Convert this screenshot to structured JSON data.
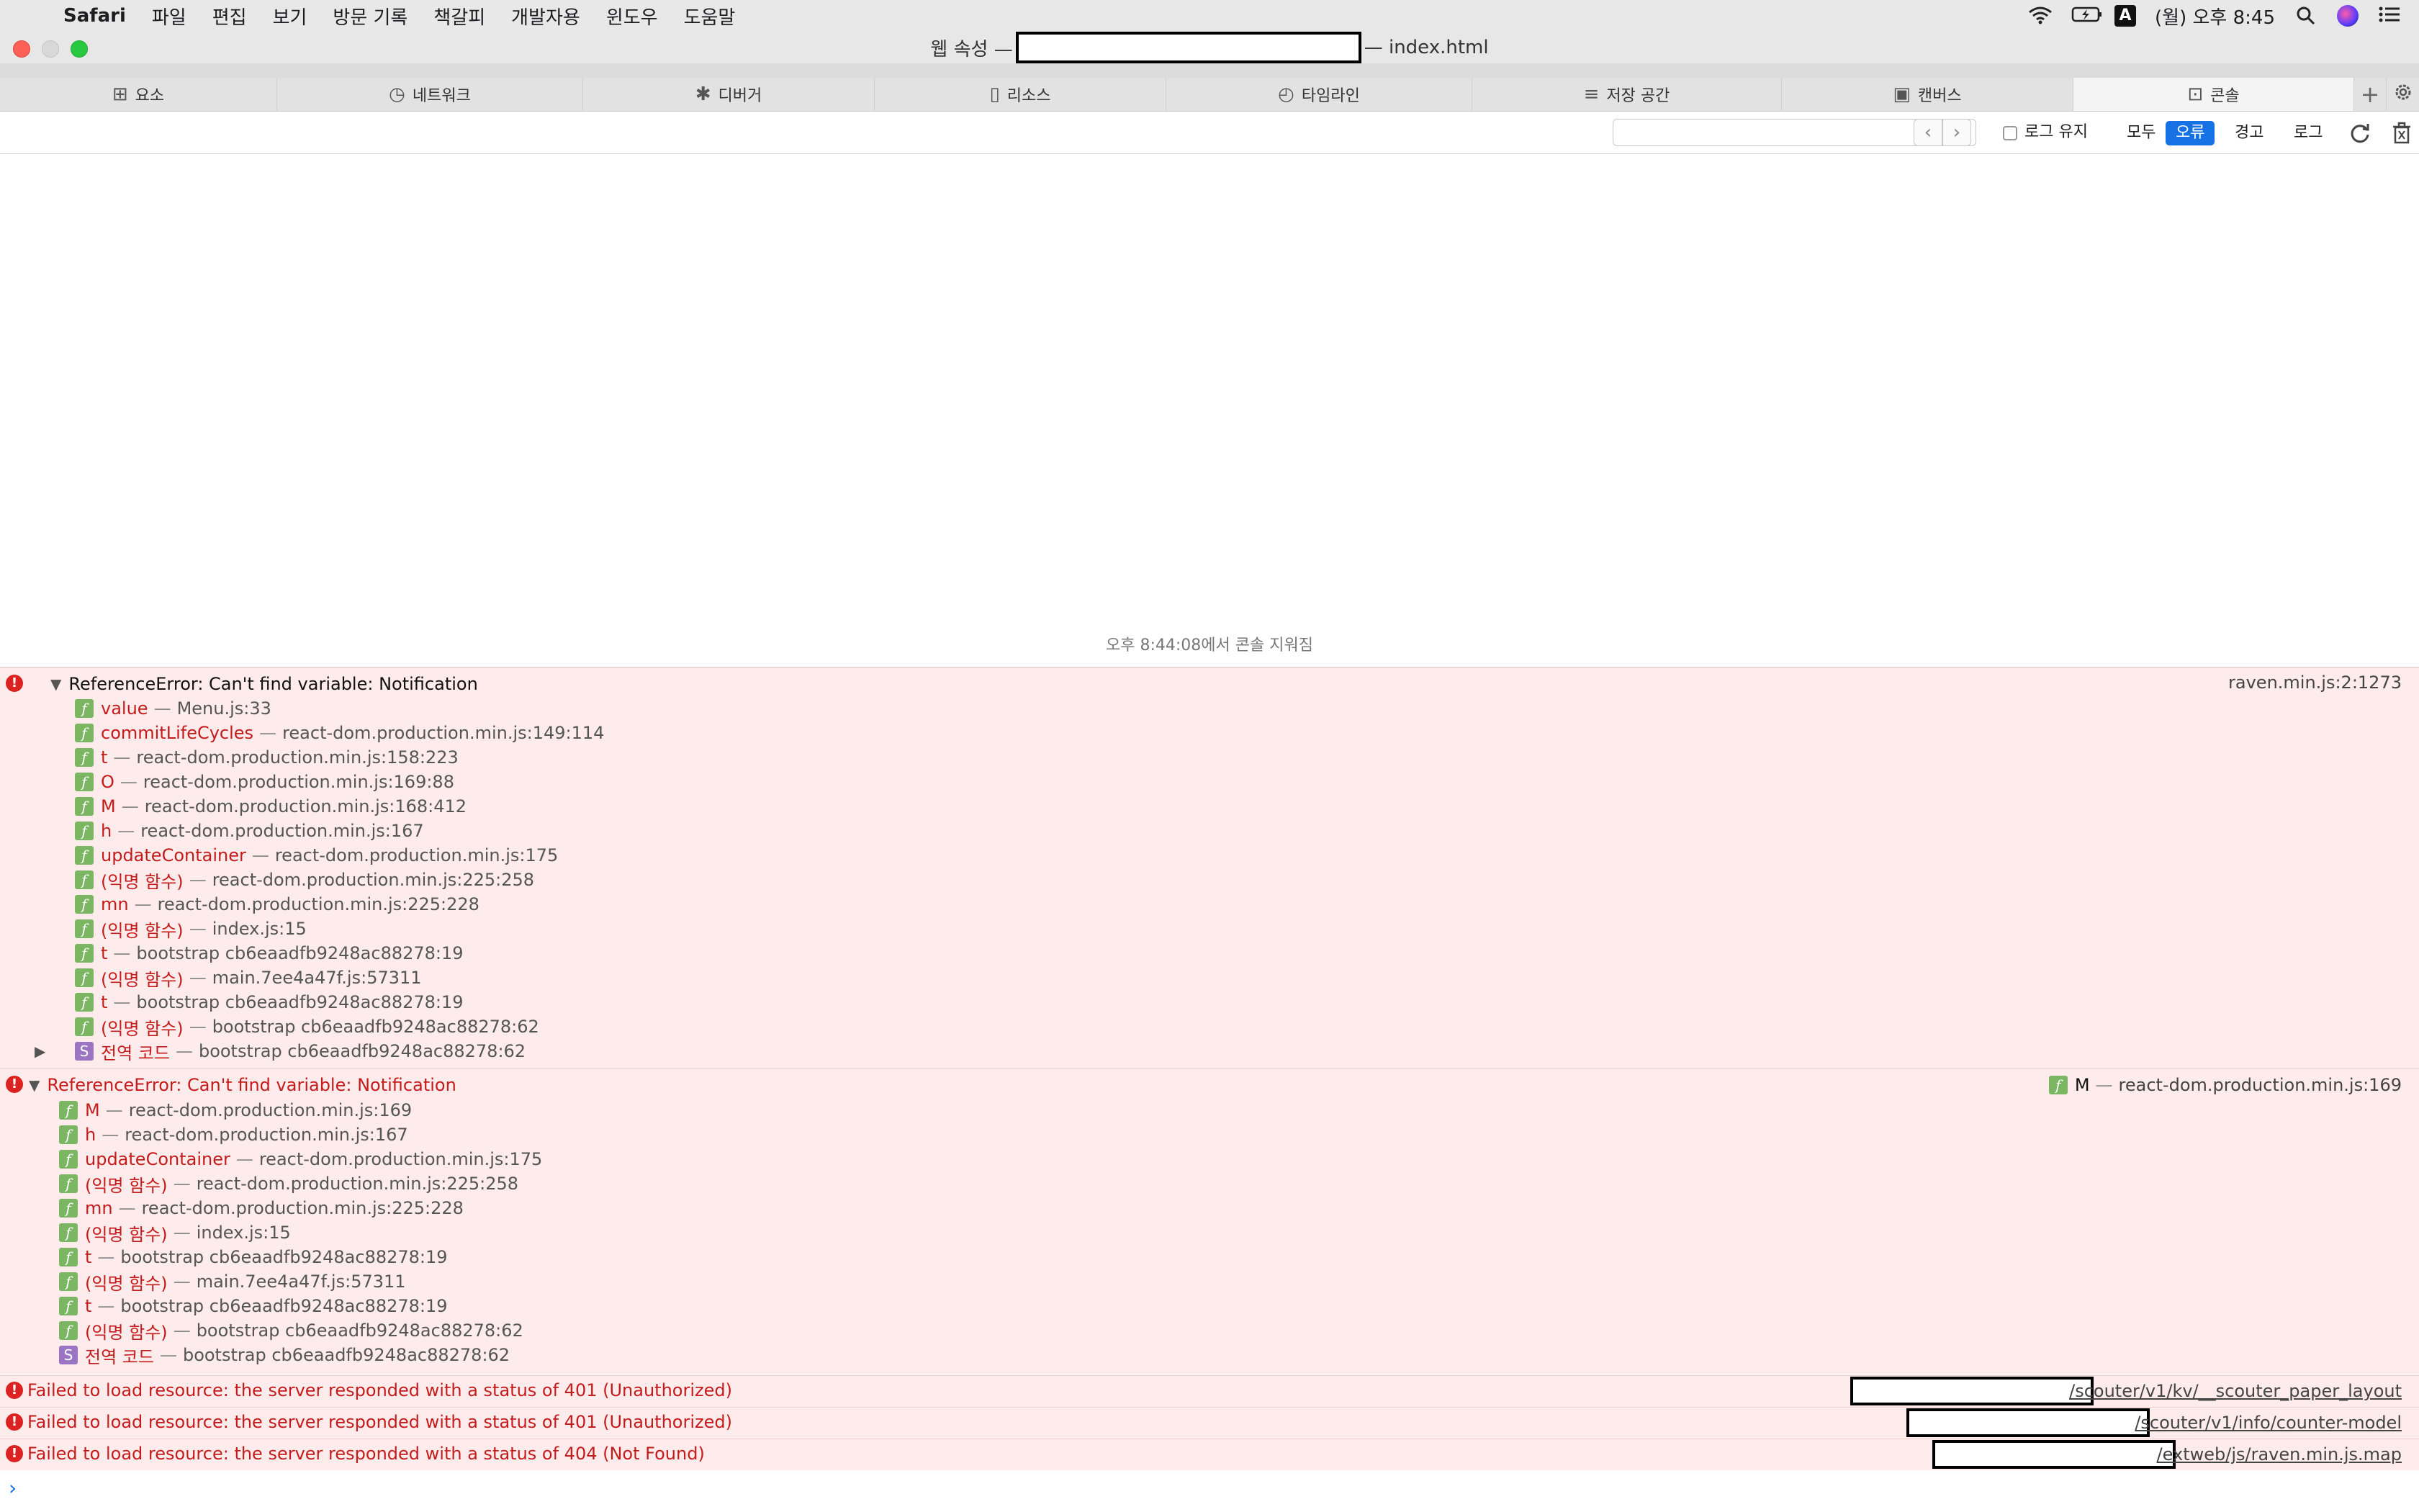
{
  "menubar": {
    "app": "Safari",
    "items": [
      "파일",
      "편집",
      "보기",
      "방문 기록",
      "책갈피",
      "개발자용",
      "윈도우",
      "도움말"
    ],
    "input_badge": "A",
    "clock": "(월) 오후 8:45"
  },
  "titlebar": {
    "prefix": "웹 속성 —",
    "suffix": "— index.html"
  },
  "tabs": [
    {
      "label": "요소",
      "icon": "elements-icon",
      "glyph": "⊞"
    },
    {
      "label": "네트워크",
      "icon": "network-icon",
      "glyph": "◷"
    },
    {
      "label": "디버거",
      "icon": "debugger-icon",
      "glyph": "✱"
    },
    {
      "label": "리소스",
      "icon": "resources-icon",
      "glyph": "▯"
    },
    {
      "label": "타임라인",
      "icon": "timeline-icon",
      "glyph": "◴"
    },
    {
      "label": "저장 공간",
      "icon": "storage-icon",
      "glyph": "≡"
    },
    {
      "label": "캔버스",
      "icon": "canvas-icon",
      "glyph": "▣"
    },
    {
      "label": "콘솔",
      "icon": "console-icon",
      "glyph": "⊡"
    }
  ],
  "toolbar": {
    "search_value": "",
    "preserve_log": "로그 유지",
    "filters": [
      "모두",
      "오류",
      "경고",
      "로그"
    ],
    "selected_filter": "오류"
  },
  "console": {
    "cleared_message": "오후 8:44:08에서 콘솔 지워짐",
    "error1": {
      "message": "ReferenceError: Can't find variable: Notification",
      "location": "raven.min.js:2:1273",
      "frames": [
        {
          "fn": "value",
          "loc": "Menu.js:33",
          "badge": "f"
        },
        {
          "fn": "commitLifeCycles",
          "loc": "react-dom.production.min.js:149:114",
          "badge": "f"
        },
        {
          "fn": "t",
          "loc": "react-dom.production.min.js:158:223",
          "badge": "f"
        },
        {
          "fn": "O",
          "loc": "react-dom.production.min.js:169:88",
          "badge": "f"
        },
        {
          "fn": "M",
          "loc": "react-dom.production.min.js:168:412",
          "badge": "f"
        },
        {
          "fn": "h",
          "loc": "react-dom.production.min.js:167",
          "badge": "f"
        },
        {
          "fn": "updateContainer",
          "loc": "react-dom.production.min.js:175",
          "badge": "f"
        },
        {
          "fn": "(익명 함수)",
          "loc": "react-dom.production.min.js:225:258",
          "badge": "f"
        },
        {
          "fn": "mn",
          "loc": "react-dom.production.min.js:225:228",
          "badge": "f"
        },
        {
          "fn": "(익명 함수)",
          "loc": "index.js:15",
          "badge": "f"
        },
        {
          "fn": "t",
          "loc": "bootstrap cb6eaadfb9248ac88278:19",
          "badge": "f"
        },
        {
          "fn": "(익명 함수)",
          "loc": "main.7ee4a47f.js:57311",
          "badge": "f"
        },
        {
          "fn": "t",
          "loc": "bootstrap cb6eaadfb9248ac88278:19",
          "badge": "f"
        },
        {
          "fn": "(익명 함수)",
          "loc": "bootstrap cb6eaadfb9248ac88278:62",
          "badge": "f"
        },
        {
          "fn": "전역 코드",
          "loc": "bootstrap cb6eaadfb9248ac88278:62",
          "badge": "S"
        }
      ]
    },
    "error2": {
      "message": "ReferenceError: Can't find variable: Notification",
      "location_fn": "M",
      "location": "react-dom.production.min.js:169",
      "frames": [
        {
          "fn": "M",
          "loc": "react-dom.production.min.js:169",
          "badge": "f"
        },
        {
          "fn": "h",
          "loc": "react-dom.production.min.js:167",
          "badge": "f"
        },
        {
          "fn": "updateContainer",
          "loc": "react-dom.production.min.js:175",
          "badge": "f"
        },
        {
          "fn": "(익명 함수)",
          "loc": "react-dom.production.min.js:225:258",
          "badge": "f"
        },
        {
          "fn": "mn",
          "loc": "react-dom.production.min.js:225:228",
          "badge": "f"
        },
        {
          "fn": "(익명 함수)",
          "loc": "index.js:15",
          "badge": "f"
        },
        {
          "fn": "t",
          "loc": "bootstrap cb6eaadfb9248ac88278:19",
          "badge": "f"
        },
        {
          "fn": "(익명 함수)",
          "loc": "main.7ee4a47f.js:57311",
          "badge": "f"
        },
        {
          "fn": "t",
          "loc": "bootstrap cb6eaadfb9248ac88278:19",
          "badge": "f"
        },
        {
          "fn": "(익명 함수)",
          "loc": "bootstrap cb6eaadfb9248ac88278:62",
          "badge": "f"
        },
        {
          "fn": "전역 코드",
          "loc": "bootstrap cb6eaadfb9248ac88278:62",
          "badge": "S"
        }
      ]
    },
    "resource_errors": [
      {
        "message": "Failed to load resource: the server responded with a status of 401 (Unauthorized)",
        "url": "/scouter/v1/kv/__scouter_paper_layout"
      },
      {
        "message": "Failed to load resource: the server responded with a status of 401 (Unauthorized)",
        "url": "/scouter/v1/info/counter-model"
      },
      {
        "message": "Failed to load resource: the server responded with a status of 404 (Not Found)",
        "url": "/extweb/js/raven.min.js.map"
      }
    ],
    "prompt": "›"
  }
}
